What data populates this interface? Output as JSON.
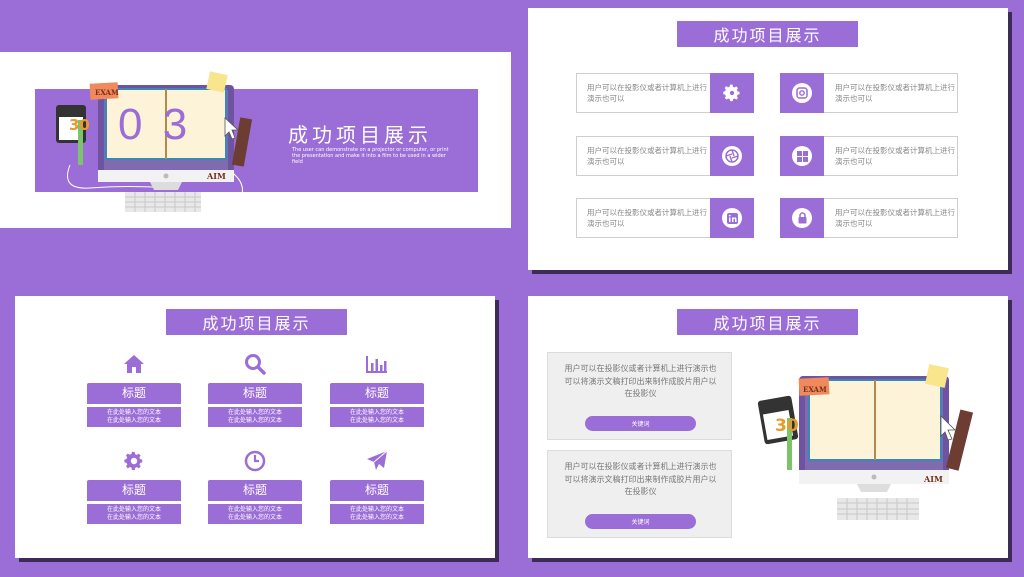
{
  "colors": {
    "purple": "#9b6dd6",
    "dark_shadow": "#3d2b57",
    "white": "#ffffff"
  },
  "slide1": {
    "number": "0 3",
    "title": "成功项目展示",
    "description": "The user can demonstrate on a projector or computer, or print the presentation and make it into a film to be used in a wider field",
    "sticker_exam": "EXAM",
    "sticker_aim": "AIM",
    "calendar_number": "30"
  },
  "slide2": {
    "title": "成功项目展示",
    "cards": [
      {
        "text": "用户可以在投影仪或者计算机上进行演示也可以",
        "icon": "gear-icon"
      },
      {
        "text": "用户可以在投影仪或者计算机上进行演示也可以",
        "icon": "instagram-icon"
      },
      {
        "text": "用户可以在投影仪或者计算机上进行演示也可以",
        "icon": "aperture-icon"
      },
      {
        "text": "用户可以在投影仪或者计算机上进行演示也可以",
        "icon": "windows-icon"
      },
      {
        "text": "用户可以在投影仪或者计算机上进行演示也可以",
        "icon": "linkedin-icon"
      },
      {
        "text": "用户可以在投影仪或者计算机上进行演示也可以",
        "icon": "lock-icon"
      }
    ]
  },
  "slide3": {
    "title": "成功项目展示",
    "items": [
      {
        "label": "标题",
        "sub1": "在此处输入您的文本",
        "sub2": "在此处输入您的文本",
        "icon": "home-icon"
      },
      {
        "label": "标题",
        "sub1": "在此处输入您的文本",
        "sub2": "在此处输入您的文本",
        "icon": "search-icon"
      },
      {
        "label": "标题",
        "sub1": "在此处输入您的文本",
        "sub2": "在此处输入您的文本",
        "icon": "bar-chart-icon"
      },
      {
        "label": "标题",
        "sub1": "在此处输入您的文本",
        "sub2": "在此处输入您的文本",
        "icon": "gear-icon"
      },
      {
        "label": "标题",
        "sub1": "在此处输入您的文本",
        "sub2": "在此处输入您的文本",
        "icon": "clock-icon"
      },
      {
        "label": "标题",
        "sub1": "在此处输入您的文本",
        "sub2": "在此处输入您的文本",
        "icon": "paper-plane-icon"
      }
    ]
  },
  "slide4": {
    "title": "成功项目展示",
    "boxes": [
      {
        "text": "用户可以在投影仪或者计算机上进行演示也可以将演示文稿打印出来制作成胶片用户以在投影仪",
        "button": "关键词"
      },
      {
        "text": "用户可以在投影仪或者计算机上进行演示也可以将演示文稿打印出来制作成胶片用户以在投影仪",
        "button": "关键词"
      }
    ],
    "sticker_exam": "EXAM",
    "sticker_aim": "AIM",
    "calendar_number": "30"
  }
}
